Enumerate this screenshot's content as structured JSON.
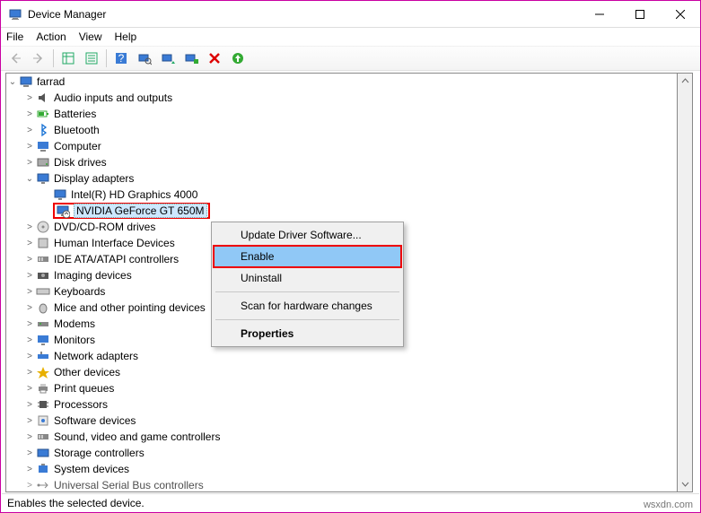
{
  "window": {
    "title": "Device Manager"
  },
  "menu": {
    "items": [
      "File",
      "Action",
      "View",
      "Help"
    ]
  },
  "tree": {
    "root": "farrad",
    "nodes": [
      {
        "label": "Audio inputs and outputs",
        "exp": "closed"
      },
      {
        "label": "Batteries",
        "exp": "closed"
      },
      {
        "label": "Bluetooth",
        "exp": "closed"
      },
      {
        "label": "Computer",
        "exp": "closed"
      },
      {
        "label": "Disk drives",
        "exp": "closed"
      },
      {
        "label": "Display adapters",
        "exp": "open",
        "children": [
          {
            "label": "Intel(R) HD Graphics 4000"
          },
          {
            "label": "NVIDIA GeForce GT 650M",
            "selected": true
          }
        ]
      },
      {
        "label": "DVD/CD-ROM drives",
        "exp": "closed"
      },
      {
        "label": "Human Interface Devices",
        "exp": "closed"
      },
      {
        "label": "IDE ATA/ATAPI controllers",
        "exp": "closed"
      },
      {
        "label": "Imaging devices",
        "exp": "closed"
      },
      {
        "label": "Keyboards",
        "exp": "closed"
      },
      {
        "label": "Mice and other pointing devices",
        "exp": "closed",
        "truncated": true
      },
      {
        "label": "Modems",
        "exp": "closed"
      },
      {
        "label": "Monitors",
        "exp": "closed"
      },
      {
        "label": "Network adapters",
        "exp": "closed"
      },
      {
        "label": "Other devices",
        "exp": "closed"
      },
      {
        "label": "Print queues",
        "exp": "closed"
      },
      {
        "label": "Processors",
        "exp": "closed"
      },
      {
        "label": "Software devices",
        "exp": "closed"
      },
      {
        "label": "Sound, video and game controllers",
        "exp": "closed"
      },
      {
        "label": "Storage controllers",
        "exp": "closed"
      },
      {
        "label": "System devices",
        "exp": "closed"
      },
      {
        "label": "Universal Serial Bus controllers",
        "exp": "closed",
        "cutoff": true
      }
    ]
  },
  "context": {
    "items": [
      {
        "label": "Update Driver Software..."
      },
      {
        "label": "Enable",
        "highlight": true
      },
      {
        "label": "Uninstall"
      },
      {
        "sep": true
      },
      {
        "label": "Scan for hardware changes"
      },
      {
        "sep": true
      },
      {
        "label": "Properties",
        "bold": true
      }
    ]
  },
  "status": {
    "text": "Enables the selected device."
  },
  "watermark": "wsxdn.com"
}
